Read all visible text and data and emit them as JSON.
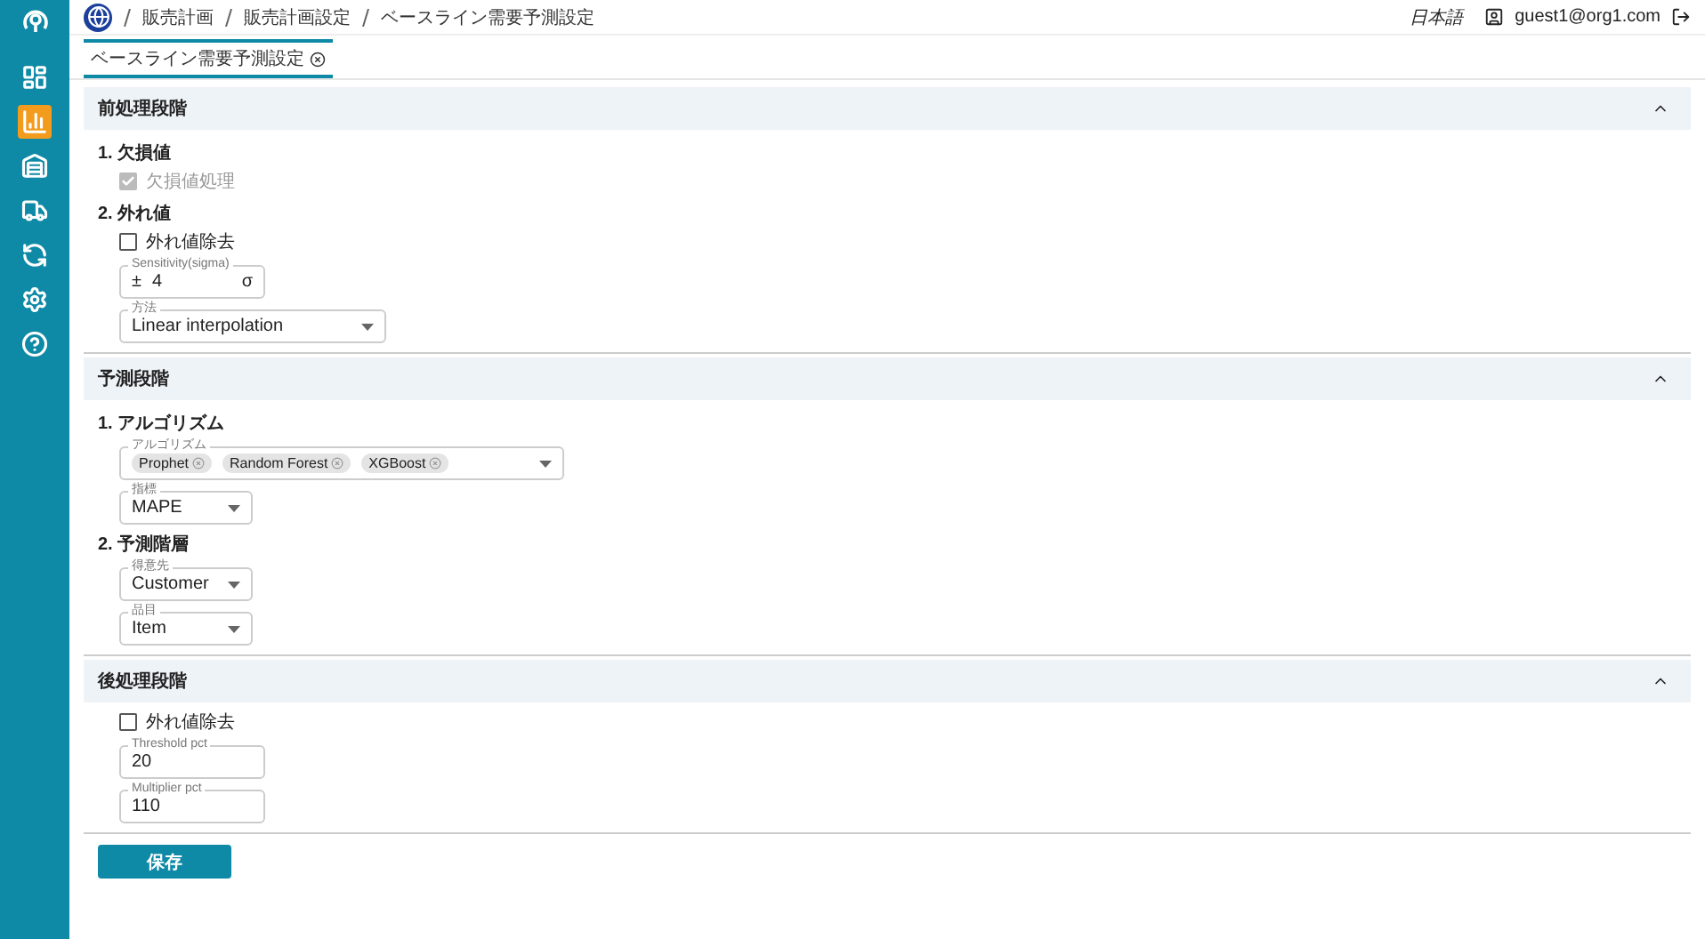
{
  "sidebar": {
    "items": [
      {
        "selected": false
      },
      {
        "selected": true
      },
      {
        "selected": false
      },
      {
        "selected": false
      },
      {
        "selected": false
      },
      {
        "selected": false
      },
      {
        "selected": false
      }
    ]
  },
  "breadcrumb": [
    "販売計画",
    "販売計画設定",
    "ベースライン需要予測設定"
  ],
  "header": {
    "language": "日本語",
    "user": "guest1@org1.com"
  },
  "tabs": [
    {
      "label": "ベースライン需要予測設定",
      "selected": true
    }
  ],
  "sections": [
    {
      "title": "前処理段階",
      "expanded": true,
      "items": [
        {
          "kind": "heading",
          "text": "1. 欠損値"
        },
        {
          "kind": "checkbox",
          "label": "欠損値処理",
          "checked": true,
          "disabled": true
        },
        {
          "kind": "heading",
          "text": "2. 外れ値"
        },
        {
          "kind": "checkbox",
          "label": "外れ値除去",
          "checked": false,
          "disabled": false
        },
        {
          "kind": "number",
          "label": "Sensitivity(sigma)",
          "prefix": "±",
          "value": "4",
          "suffix": "σ"
        },
        {
          "kind": "wide_select",
          "label": "方法",
          "value": "Linear interpolation"
        }
      ]
    },
    {
      "title": "予測段階",
      "expanded": true,
      "items": [
        {
          "kind": "heading",
          "text": "1. アルゴリズム"
        },
        {
          "kind": "multiselect",
          "label": "アルゴリズム",
          "chips": [
            "Prophet",
            "Random Forest",
            "XGBoost"
          ]
        },
        {
          "kind": "select",
          "label": "指標",
          "value": "MAPE"
        },
        {
          "kind": "heading",
          "text": "2. 予測階層"
        },
        {
          "kind": "select",
          "label": "得意先",
          "value": "Customer"
        },
        {
          "kind": "select",
          "label": "品目",
          "value": "Item"
        }
      ]
    },
    {
      "title": "後処理段階",
      "expanded": true,
      "items": [
        {
          "kind": "checkbox",
          "label": "外れ値除去",
          "checked": false,
          "disabled": false
        },
        {
          "kind": "text",
          "label": "Threshold pct",
          "value": "20"
        },
        {
          "kind": "text",
          "label": "Multiplier pct",
          "value": "110"
        }
      ]
    }
  ],
  "save_button": "保存"
}
